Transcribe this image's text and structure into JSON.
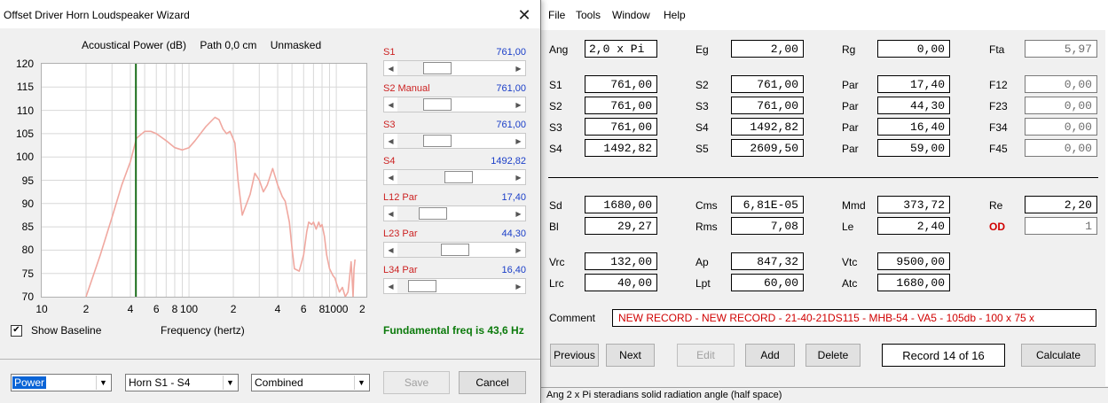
{
  "dialog": {
    "title": "Offset Driver Horn Loudspeaker Wizard",
    "close_glyph": "✕",
    "chart_header": [
      "Acoustical Power (dB)",
      "Path 0,0 cm",
      "Unmasked"
    ],
    "show_baseline_label": "Show Baseline",
    "show_baseline_checked": true,
    "fundamental": "Fundamental freq is 43,6 Hz",
    "sliders": [
      {
        "label": "S1",
        "value": "761,00",
        "position": 0.3
      },
      {
        "label": "S2  Manual",
        "value": "761,00",
        "position": 0.3
      },
      {
        "label": "S3",
        "value": "761,00",
        "position": 0.3
      },
      {
        "label": "S4",
        "value": "1492,82",
        "position": 0.55
      },
      {
        "label": "L12  Par",
        "value": "17,40",
        "position": 0.25
      },
      {
        "label": "L23  Par",
        "value": "44,30",
        "position": 0.5
      },
      {
        "label": "L34  Par",
        "value": "16,40",
        "position": 0.12
      }
    ],
    "combos": [
      {
        "value": "Power",
        "selected": true
      },
      {
        "value": "Horn S1 - S4",
        "selected": false
      },
      {
        "value": "Combined",
        "selected": false
      }
    ],
    "save_label": "Save",
    "cancel_label": "Cancel",
    "colors": {
      "curve": "#f0a8a0",
      "marker": "#1a6e1a",
      "grid": "#d8d8d8"
    }
  },
  "chart_data": {
    "type": "line",
    "title": "",
    "xlabel": "Frequency (hertz)",
    "ylabel": "Acoustical Power (dB)",
    "xscale": "log",
    "xlim": [
      10,
      1600
    ],
    "ylim": [
      70,
      120
    ],
    "yticks": [
      70,
      75,
      80,
      85,
      90,
      95,
      100,
      105,
      110,
      115,
      120
    ],
    "xtick_labels": [
      {
        "x": 10,
        "label": "10"
      },
      {
        "x": 20,
        "label": "2"
      },
      {
        "x": 40,
        "label": "4"
      },
      {
        "x": 60,
        "label": "6"
      },
      {
        "x": 80,
        "label": "8"
      },
      {
        "x": 100,
        "label": "100"
      },
      {
        "x": 200,
        "label": "2"
      },
      {
        "x": 400,
        "label": "4"
      },
      {
        "x": 600,
        "label": "6"
      },
      {
        "x": 800,
        "label": "8"
      },
      {
        "x": 1000,
        "label": "1000"
      },
      {
        "x": 1500,
        "label": "2"
      }
    ],
    "marker_x": 43.6,
    "grid": true,
    "series": [
      {
        "x": [
          20,
          25,
          30,
          35,
          40,
          44,
          50,
          55,
          60,
          70,
          80,
          90,
          100,
          110,
          130,
          150,
          160,
          170,
          180,
          190,
          205,
          215,
          230,
          260,
          280,
          300,
          320,
          340,
          370,
          400,
          430,
          450,
          480,
          500,
          520,
          560,
          600,
          630,
          650,
          680,
          700,
          730,
          760,
          780,
          800,
          830,
          860,
          900,
          950,
          980,
          1000,
          1050,
          1100,
          1150,
          1200,
          1230,
          1260,
          1280,
          1300,
          1320,
          1340
        ],
        "y": [
          70,
          79,
          87,
          94,
          99,
          104,
          105.5,
          105.5,
          105,
          103.5,
          102,
          101.5,
          102,
          103.5,
          106.5,
          108.5,
          108,
          106,
          105,
          105.5,
          103,
          95,
          87.5,
          92,
          96.5,
          95,
          92.5,
          94,
          97.5,
          94,
          91.5,
          90.5,
          86,
          80.5,
          76,
          75.5,
          79,
          84,
          86,
          85.5,
          86,
          84.5,
          86,
          85,
          85.5,
          83,
          79,
          76,
          74.5,
          74,
          73,
          71,
          72,
          70,
          71,
          74,
          77.5,
          74,
          70,
          76,
          78
        ]
      }
    ]
  },
  "app": {
    "menu": [
      "File",
      "Tools",
      "Window",
      "Help"
    ],
    "fields": [
      {
        "label": "Ang",
        "value": "2,0 x Pi"
      },
      {
        "label": "Eg",
        "value": "2,00"
      },
      {
        "label": "Rg",
        "value": "0,00"
      },
      {
        "label": "Fta",
        "value": "5,97"
      },
      {
        "label": "S1",
        "value": "761,00"
      },
      {
        "label": "S2",
        "value": "761,00"
      },
      {
        "label": "Par",
        "value": "17,40"
      },
      {
        "label": "F12",
        "value": "0,00"
      },
      {
        "label": "S2",
        "value": "761,00"
      },
      {
        "label": "S3",
        "value": "761,00"
      },
      {
        "label": "Par",
        "value": "44,30"
      },
      {
        "label": "F23",
        "value": "0,00"
      },
      {
        "label": "S3",
        "value": "761,00"
      },
      {
        "label": "S4",
        "value": "1492,82"
      },
      {
        "label": "Par",
        "value": "16,40"
      },
      {
        "label": "F34",
        "value": "0,00"
      },
      {
        "label": "S4",
        "value": "1492,82"
      },
      {
        "label": "S5",
        "value": "2609,50"
      },
      {
        "label": "Par",
        "value": "59,00"
      },
      {
        "label": "F45",
        "value": "0,00"
      },
      {
        "label": "Sd",
        "value": "1680,00"
      },
      {
        "label": "Cms",
        "value": "6,81E-05"
      },
      {
        "label": "Mmd",
        "value": "373,72"
      },
      {
        "label": "Re",
        "value": "2,20"
      },
      {
        "label": "Bl",
        "value": "29,27"
      },
      {
        "label": "Rms",
        "value": "7,08"
      },
      {
        "label": "Le",
        "value": "2,40"
      },
      {
        "label": "OD",
        "value": "1"
      },
      {
        "label": "Vrc",
        "value": "132,00"
      },
      {
        "label": "Ap",
        "value": "847,32"
      },
      {
        "label": "Vtc",
        "value": "9500,00"
      },
      {
        "label": "Lrc",
        "value": "40,00"
      },
      {
        "label": "Lpt",
        "value": "60,00"
      },
      {
        "label": "Atc",
        "value": "1680,00"
      }
    ],
    "comment_label": "Comment",
    "comment": "NEW RECORD - NEW RECORD - 21-40-21DS115 - MHB-54 - VA5 - 105db - 100 x 75 x",
    "buttons": {
      "previous": "Previous",
      "next": "Next",
      "edit": "Edit",
      "add": "Add",
      "delete": "Delete",
      "calculate": "Calculate"
    },
    "record": "Record 14 of 16",
    "status": "Ang   2 x Pi steradians solid radiation angle  (half space)",
    "colors": {
      "od_label": "#d00000",
      "comment_text": "#d00000"
    }
  }
}
